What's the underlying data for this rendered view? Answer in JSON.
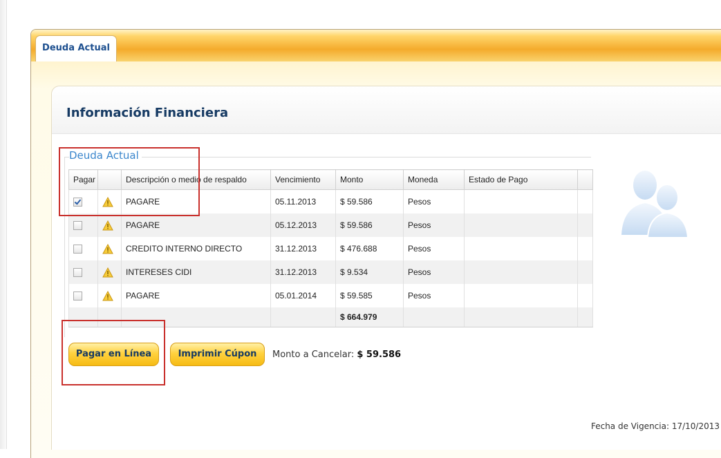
{
  "tabs": [
    {
      "label": "Deuda Actual",
      "active": true
    }
  ],
  "panel": {
    "title": "Información Financiera"
  },
  "section": {
    "legend": "Deuda Actual"
  },
  "table": {
    "headers": [
      "Pagar",
      "",
      "Descripción o medio de respaldo",
      "Vencimiento",
      "Monto",
      "Moneda",
      "Estado de Pago",
      ""
    ],
    "rows": [
      {
        "checked": true,
        "description": "PAGARE",
        "due": "05.11.2013",
        "amount": "$ 59.586",
        "currency": "Pesos",
        "status": ""
      },
      {
        "checked": false,
        "description": "PAGARE",
        "due": "05.12.2013",
        "amount": "$ 59.586",
        "currency": "Pesos",
        "status": ""
      },
      {
        "checked": false,
        "description": "CREDITO INTERNO DIRECTO",
        "due": "31.12.2013",
        "amount": "$ 476.688",
        "currency": "Pesos",
        "status": ""
      },
      {
        "checked": false,
        "description": "INTERESES CIDI",
        "due": "31.12.2013",
        "amount": "$ 9.534",
        "currency": "Pesos",
        "status": ""
      },
      {
        "checked": false,
        "description": "PAGARE",
        "due": "05.01.2014",
        "amount": "$ 59.585",
        "currency": "Pesos",
        "status": ""
      }
    ],
    "total": "$ 664.979"
  },
  "buttons": {
    "pay_online": "Pagar en Línea",
    "print_coupon": "Imprimir Cúpon"
  },
  "monto_cancelar": {
    "label": "Monto a Cancelar:",
    "value": "$ 59.586"
  },
  "footer": {
    "fecha_label": "Fecha de Vigencia:",
    "fecha_value": "17/10/2013"
  },
  "icons": {
    "row_icon": "warning-icon",
    "avatar": "users-icon"
  },
  "colors": {
    "accent_orange": "#f4ab2c",
    "button_yellow": "#ffd23f",
    "title_blue": "#163a63",
    "link_blue": "#3a86cc",
    "highlight_red": "#c9302c"
  }
}
